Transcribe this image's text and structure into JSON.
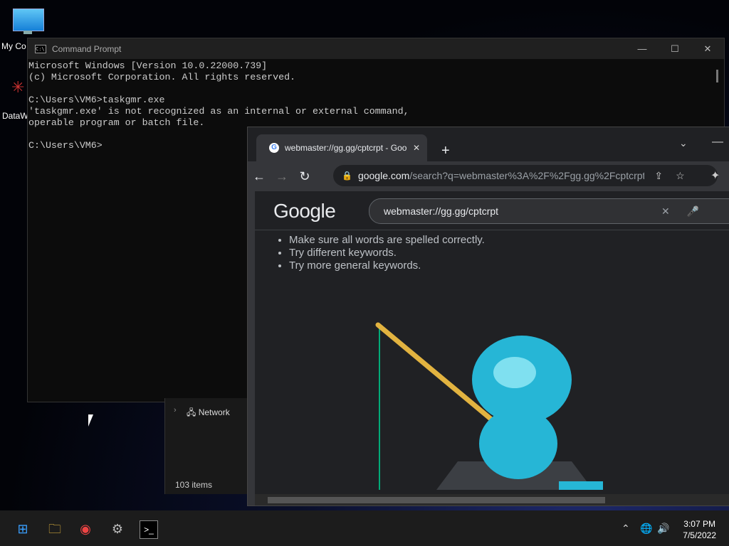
{
  "desktop": {
    "icon1": "My Co",
    "icon2": "DataW"
  },
  "cmd": {
    "title": "Command Prompt",
    "minimize": "—",
    "maximize": "☐",
    "close": "✕",
    "lines": "Microsoft Windows [Version 10.0.22000.739]\n(c) Microsoft Corporation. All rights reserved.\n\nC:\\Users\\VM6>taskgmr.exe\n'taskgmr.exe' is not recognized as an internal or external command,\noperable program or batch file.\n\nC:\\Users\\VM6>"
  },
  "explorer": {
    "network": "Network",
    "items": "103 items"
  },
  "chrome": {
    "tab_title": "webmaster://gg.gg/cptcrpt - Goo",
    "url_host": "google.com",
    "url_path": "/search?q=webmaster%3A%2F%2Fgg.gg%2Fcptcrpt...",
    "logo": "Google",
    "query": "webmaster://gg.gg/cptcrpt",
    "tips": [
      "Make sure all words are spelled correctly.",
      "Try different keywords.",
      "Try more general keywords."
    ]
  },
  "clock": {
    "time": "3:07 PM",
    "date": "7/5/2022"
  }
}
